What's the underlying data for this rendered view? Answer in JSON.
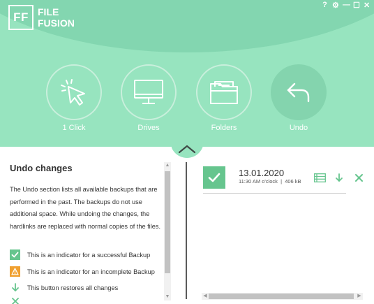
{
  "app": {
    "logo_mark": "FF",
    "logo_line1": "FILE",
    "logo_line2": "FUSION",
    "window_controls": [
      "?",
      "⚙",
      "—",
      "☐",
      "✕"
    ]
  },
  "colors": {
    "header_bg": "#97e4bf",
    "accent_green": "#66c58e",
    "warning_orange": "#f0a030",
    "text_dark": "#333333"
  },
  "nav": {
    "items": [
      {
        "label": "1 Click",
        "icon": "cursor-click-icon",
        "active": false
      },
      {
        "label": "Drives",
        "icon": "monitor-icon",
        "active": false
      },
      {
        "label": "Folders",
        "icon": "folder-icon",
        "active": false
      },
      {
        "label": "Undo",
        "icon": "undo-arrow-icon",
        "active": true
      }
    ]
  },
  "left_panel": {
    "title": "Undo changes",
    "description": "The Undo section lists all available backups that are performed in the past. The backups do not use additional space. While undoing the changes, the hardlinks are replaced with normal copies of the files.",
    "legend": [
      {
        "icon": "checkmark-icon",
        "text": "This is an indicator for a successful Backup"
      },
      {
        "icon": "warning-icon",
        "text": "This is an indicator for an incomplete Backup"
      },
      {
        "icon": "download-arrow-icon",
        "text": "This button restores all changes"
      }
    ]
  },
  "backups": [
    {
      "date": "13.01.2020",
      "time": "11:30 AM o'clock",
      "separator": "|",
      "size": "406 kB",
      "status": "successful"
    }
  ]
}
